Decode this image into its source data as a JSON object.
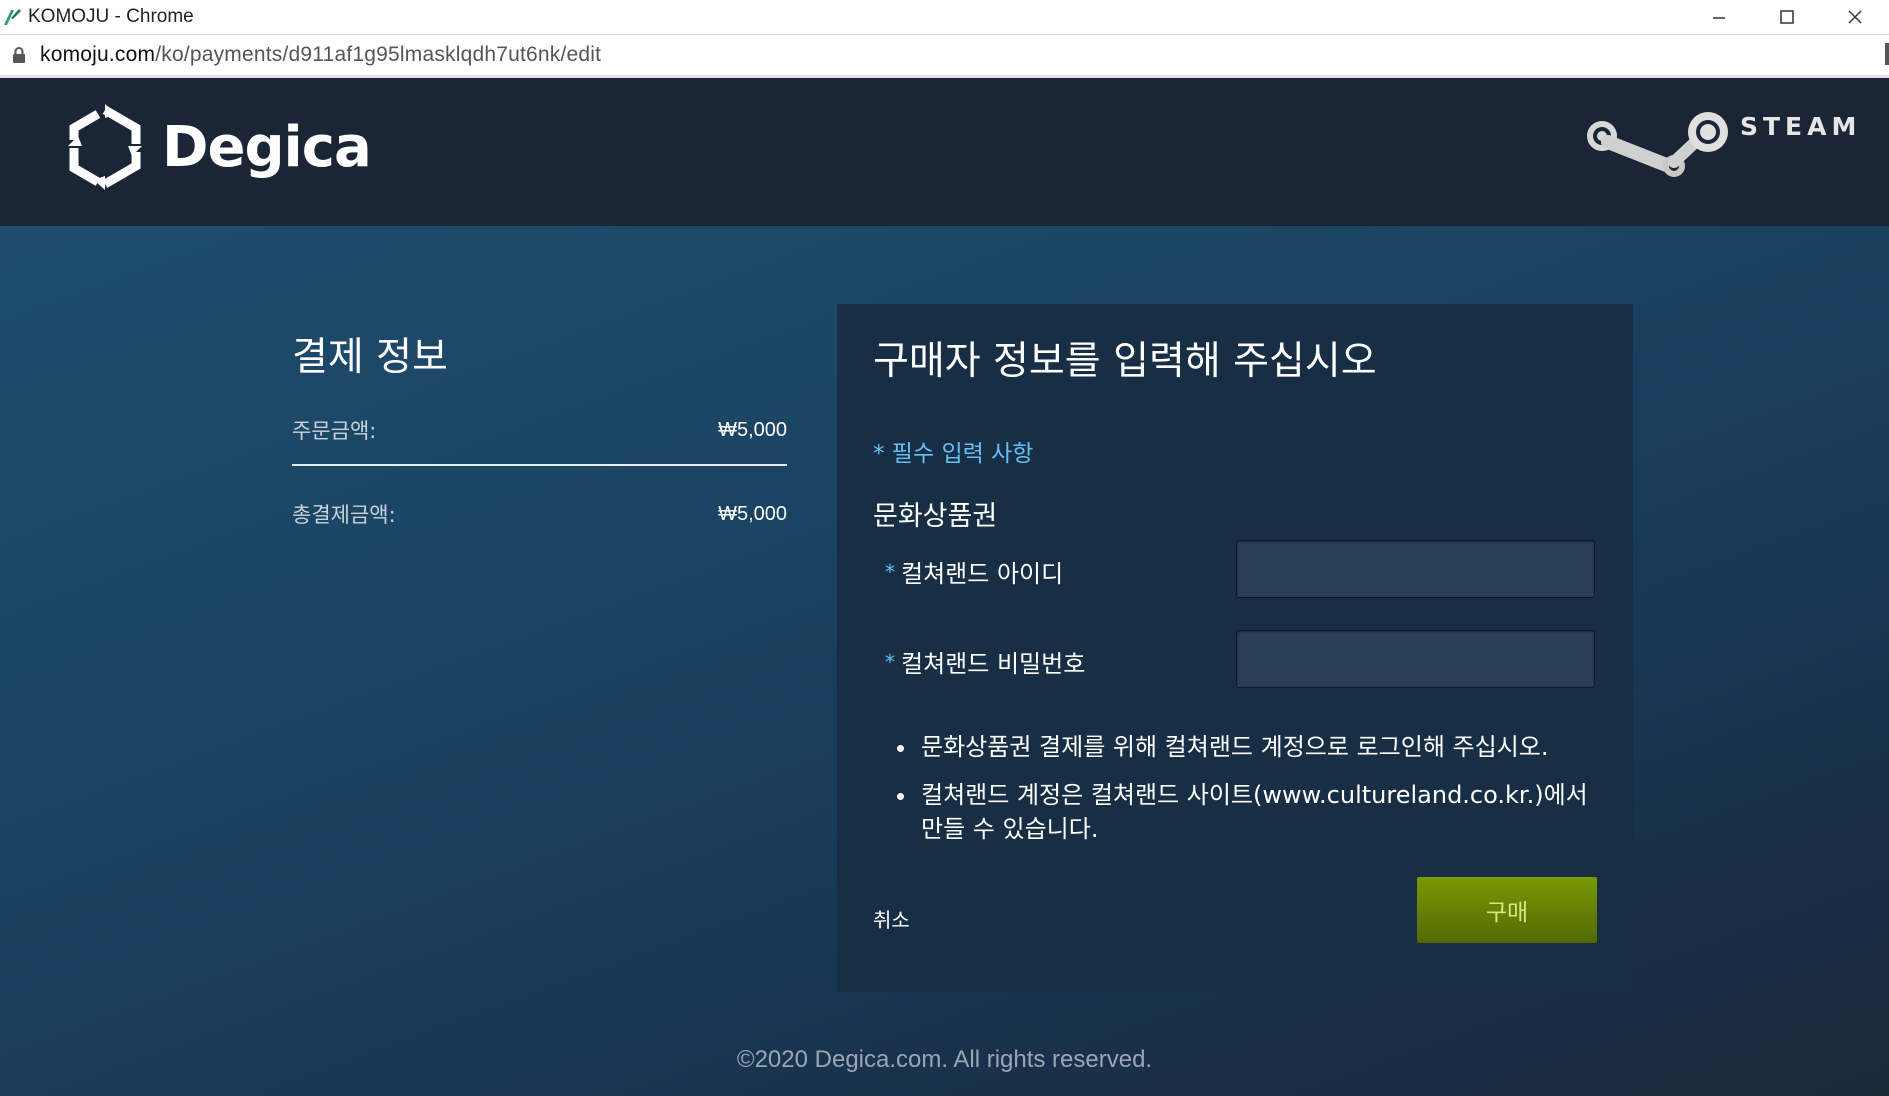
{
  "window": {
    "title": "KOMOJU - Chrome"
  },
  "address_bar": {
    "host": "komoju.com",
    "path": "/ko/payments/d911af1g95lmasklqdh7ut6nk/edit"
  },
  "header": {
    "brand_left": "Degica",
    "brand_right": "STEAM"
  },
  "payment_info": {
    "title": "결제 정보",
    "order_amount_label": "주문금액:",
    "order_amount_value": "₩5,000",
    "total_label": "총결제금액:",
    "total_value": "₩5,000"
  },
  "form": {
    "title": "구매자 정보를 입력해 주십시오",
    "required_note": "* 필수 입력 사항",
    "section_title": "문화상품권",
    "fields": [
      {
        "star": "*",
        "label": "컬쳐랜드 아이디",
        "value": ""
      },
      {
        "star": "*",
        "label": "컬쳐랜드 비밀번호",
        "value": ""
      }
    ],
    "notes": [
      "문화상품권 결제를 위해 컬쳐랜드 계정으로 로그인해 주십시오.",
      "컬쳐랜드 계정은 컬쳐랜드 사이트(www.cultureland.co.kr.)에서 만들 수 있습니다."
    ],
    "cancel_label": "취소",
    "buy_label": "구매"
  },
  "footer": {
    "copyright": "©2020 Degica.com. All rights reserved."
  },
  "colors": {
    "header_bg": "#1a2535",
    "panel_bg": "#172e45",
    "accent_blue": "#66c0f4",
    "buy_green": "#799905"
  }
}
